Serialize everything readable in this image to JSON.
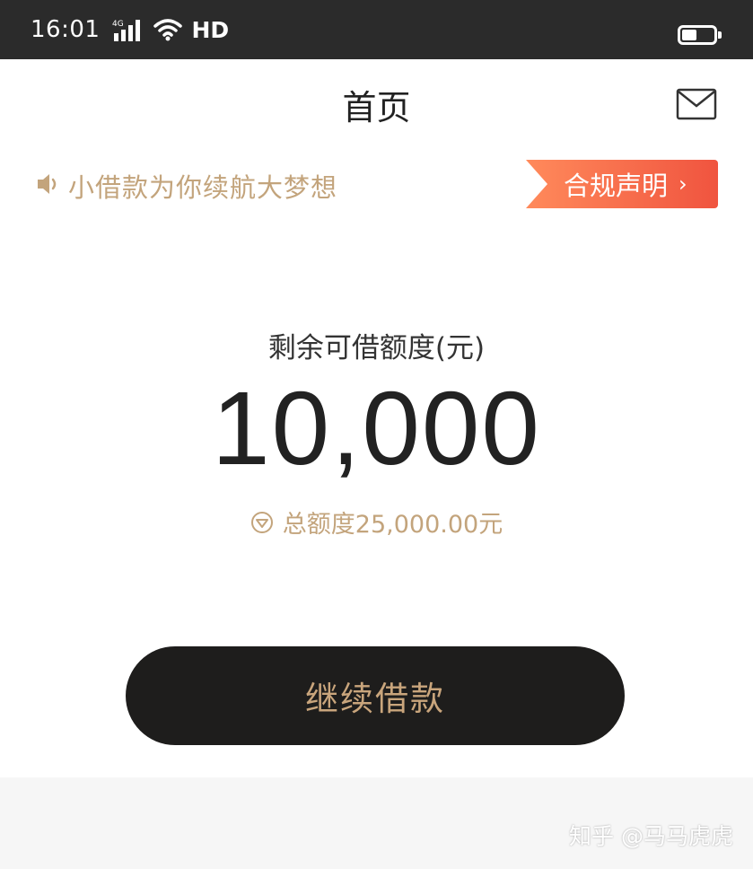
{
  "status_bar": {
    "time": "16:01",
    "network": "4G",
    "hd": "HD"
  },
  "header": {
    "title": "首页"
  },
  "notice": {
    "text": "小借款为你续航大梦想",
    "compliance_label": "合规声明"
  },
  "credit": {
    "label": "剩余可借额度(元)",
    "amount": "10,000",
    "total": "总额度25,000.00元"
  },
  "actions": {
    "continue_label": "继续借款"
  },
  "watermark": {
    "text": "知乎 @马马虎虎"
  },
  "colors": {
    "status_bar_bg": "#2b2b2b",
    "gold": "#c3a47c",
    "button_bg": "#1e1d1c",
    "compliance_start": "#ff8a5b",
    "compliance_end": "#f0543f"
  },
  "icons": [
    "signal-icon",
    "wifi-icon",
    "battery-icon",
    "mail-icon",
    "speaker-icon",
    "chevron-right-icon",
    "shield-icon"
  ]
}
